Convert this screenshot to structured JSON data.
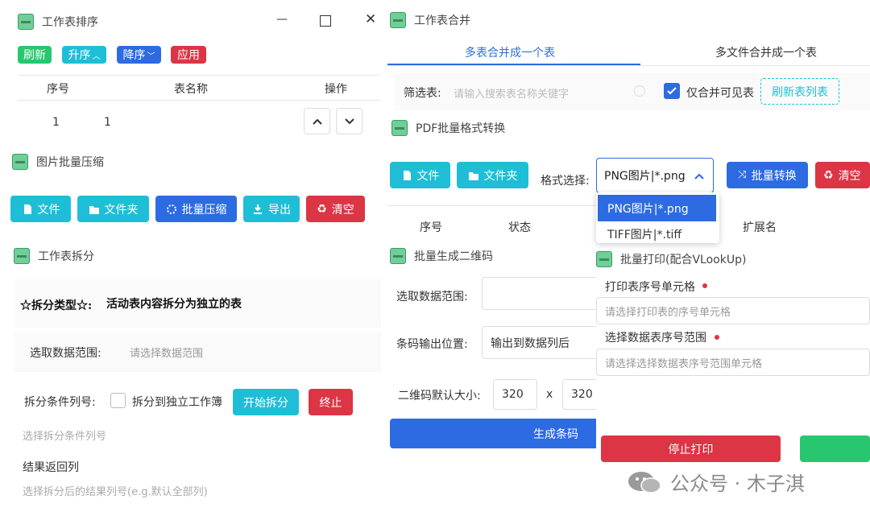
{
  "sort_panel": {
    "title": "工作表排序",
    "buttons": {
      "refresh": "刷新",
      "asc": "升序",
      "desc": "降序",
      "apply": "应用"
    },
    "columns": [
      "序号",
      "表名称",
      "操作"
    ],
    "rows": [
      {
        "index": "1",
        "name": "1"
      }
    ]
  },
  "compress_panel": {
    "title": "图片批量压缩",
    "buttons": {
      "file": "文件",
      "folder": "文件夹",
      "compress": "批量压缩",
      "export": "导出",
      "clear": "清空"
    }
  },
  "split_panel": {
    "title": "工作表拆分",
    "type_label": "☆拆分类型☆:",
    "type_value": "活动表内容拆分为独立的表",
    "range_label": "选取数据范围:",
    "range_placeholder": "请选择数据范围",
    "cond_label": "拆分条件列号:",
    "checkbox_label": "拆分到独立工作簿",
    "start_button": "开始拆分",
    "stop_button": "终止",
    "cond_placeholder": "选择拆分条件列号",
    "result_label": "结果返回列",
    "result_placeholder": "选择拆分后的结果列号(e.g.默认全部列)"
  },
  "merge_panel": {
    "title": "工作表合并",
    "tabs": [
      "多表合并成一个表",
      "多文件合并成一个表"
    ],
    "filter_label": "筛选表:",
    "filter_placeholder": "请输入搜索表名称关键字",
    "visible_only_label": "仅合并可见表",
    "refresh_button": "刷新表列表"
  },
  "pdf_panel": {
    "title": "PDF批量格式转换",
    "buttons": {
      "file": "文件",
      "folder": "文件夹",
      "convert": "批量转换",
      "clear": "清空"
    },
    "format_label": "格式选择:",
    "format_value": "PNG图片|*.png",
    "format_options": [
      "PNG图片|*.png",
      "TIFF图片|*.tiff"
    ],
    "columns": [
      "序号",
      "状态",
      "扩展名"
    ]
  },
  "qr_panel": {
    "title": "批量生成二维码",
    "range_label": "选取数据范围:",
    "output_label": "条码输出位置:",
    "output_value": "输出到数据列后",
    "size_label": "二维码默认大小:",
    "width": "320",
    "x": "x",
    "height": "320",
    "generate_button": "生成条码"
  },
  "print_panel": {
    "title": "批量打印(配合VLookUp)",
    "cell_label": "打印表序号单元格",
    "cell_placeholder": "请选择打印表的序号单元格",
    "range_label": "选择数据表序号范围",
    "range_placeholder": "请选择选择数据表序号范围单元格",
    "stop_button": "停止打印"
  },
  "window": {
    "minimize": "—",
    "maximize": "☐",
    "close": "✕"
  },
  "watermark": "公众号 · 木子淇",
  "colors": {
    "teal": "#1ebfd6",
    "blue": "#2d6be3",
    "red": "#dc3545",
    "green": "#28c76f"
  }
}
